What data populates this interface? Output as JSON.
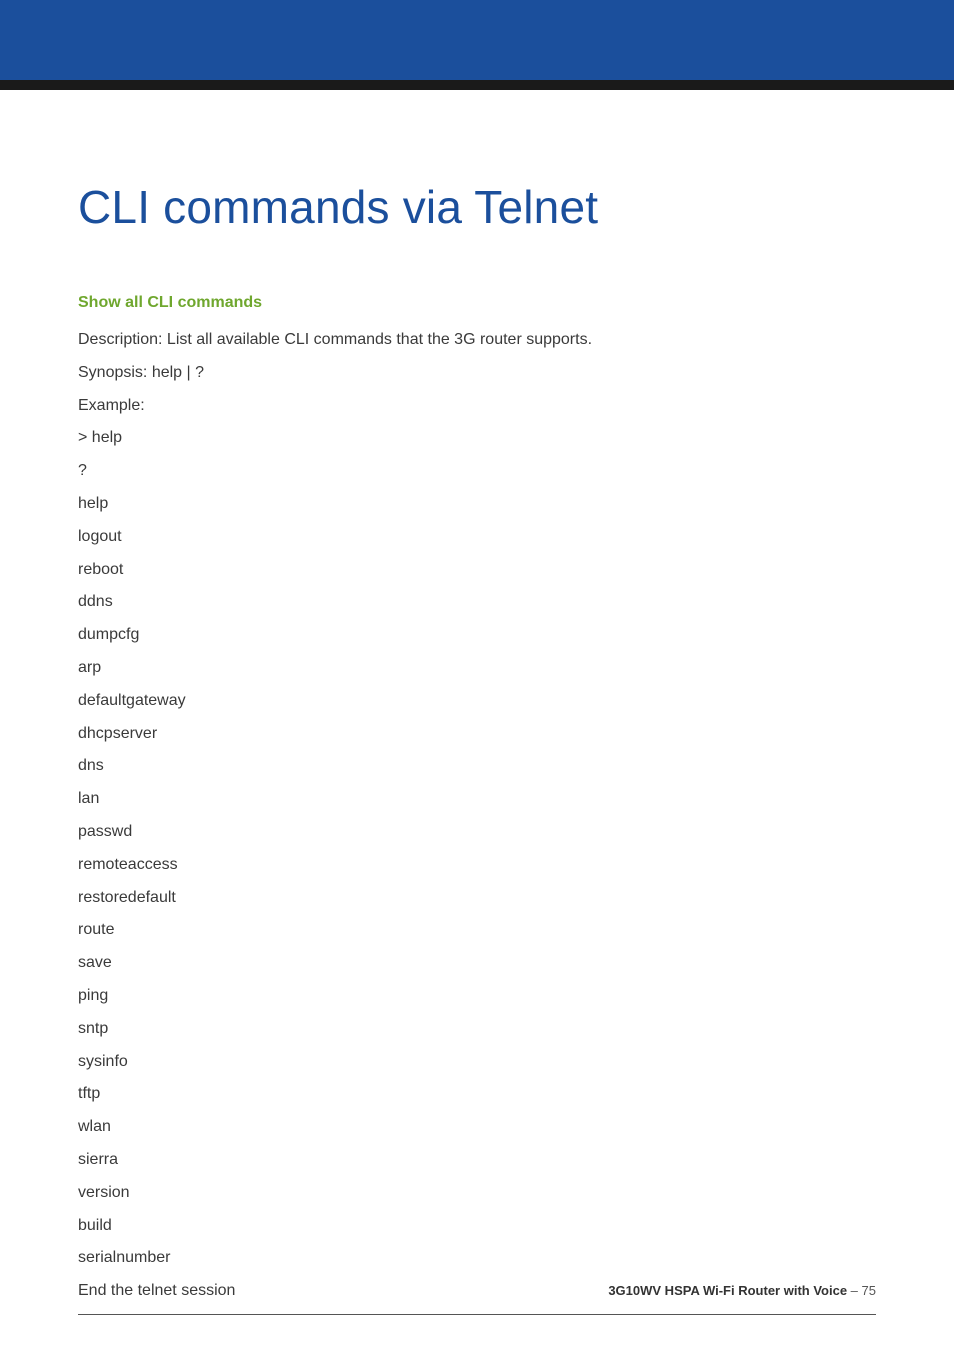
{
  "title": "CLI commands via Telnet",
  "section_heading": "Show all CLI commands",
  "lines": [
    "Description: List all available CLI commands that the 3G router supports.",
    "Synopsis: help | ?",
    "Example:",
    "> help",
    "?",
    "help",
    "logout",
    "reboot",
    "ddns",
    "dumpcfg",
    "arp",
    "defaultgateway",
    "dhcpserver",
    "dns",
    "lan",
    "passwd",
    "remoteaccess",
    "restoredefault",
    "route",
    "save",
    "ping",
    "sntp",
    "sysinfo",
    "tftp",
    "wlan",
    "sierra",
    "version",
    "build",
    "serialnumber",
    "End the telnet session"
  ],
  "footer": {
    "product": "3G10WV HSPA Wi-Fi Router with Voice",
    "separator": " – ",
    "page": "75"
  }
}
